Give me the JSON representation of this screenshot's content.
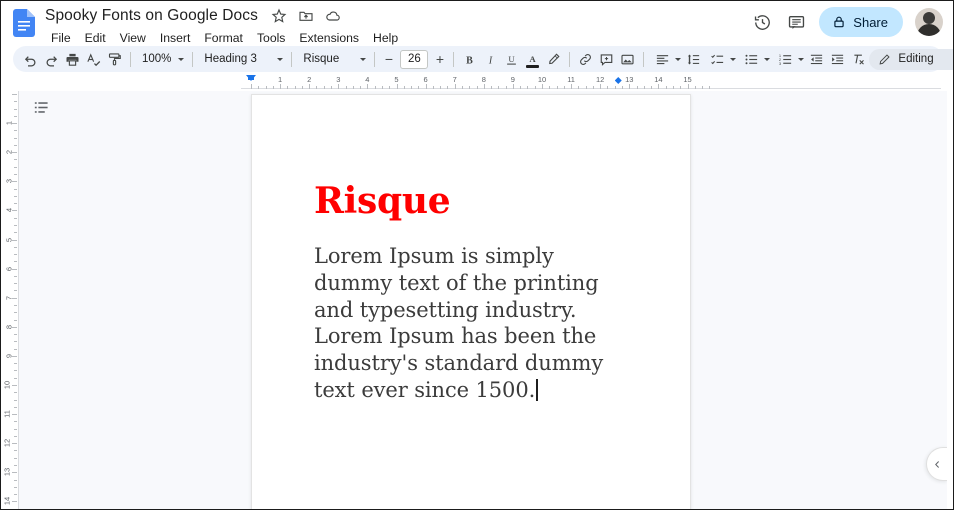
{
  "app": {
    "product": "Google Docs",
    "doc_title": "Spooky Fonts on Google Docs"
  },
  "titlebar": {
    "icons": [
      {
        "name": "star-icon",
        "label": "Star"
      },
      {
        "name": "move-to-folder-icon",
        "label": "Move"
      },
      {
        "name": "cloud-saved-icon",
        "label": "Saved to Drive"
      }
    ],
    "menus": [
      {
        "label": "File"
      },
      {
        "label": "Edit"
      },
      {
        "label": "View"
      },
      {
        "label": "Insert"
      },
      {
        "label": "Format"
      },
      {
        "label": "Tools"
      },
      {
        "label": "Extensions"
      },
      {
        "label": "Help"
      }
    ],
    "right": {
      "history_label": "Version history",
      "comments_label": "Open comment history",
      "share_label": "Share",
      "avatar_label": "Account"
    }
  },
  "toolbar": {
    "undo_label": "Undo",
    "redo_label": "Redo",
    "print_label": "Print",
    "spellcheck_label": "Spelling and grammar check",
    "paint_format_label": "Paint format",
    "zoom_value": "100%",
    "style_value": "Heading 3",
    "font_value": "Risque",
    "font_size_decrease": "−",
    "font_size_value": "26",
    "font_size_increase": "+",
    "bold_label": "B",
    "italic_label": "I",
    "underline_label": "U",
    "text_color_label": "A",
    "highlight_label": "Highlight color",
    "link_label": "Insert link",
    "comment_label": "Add comment",
    "image_label": "Insert image",
    "align_label": "Align",
    "line_spacing_label": "Line & paragraph spacing",
    "checklist_label": "Checklist",
    "bulleted_list_label": "Bulleted list",
    "numbered_list_label": "Numbered list",
    "decrease_indent_label": "Decrease indent",
    "increase_indent_label": "Increase indent",
    "clear_formatting_label": "Clear formatting",
    "mode_value": "Editing",
    "collapse_toolbar_label": "Hide the menus"
  },
  "ruler": {
    "horizontal_numbers": [
      "2",
      "1",
      "1",
      "2",
      "3",
      "4",
      "5",
      "6",
      "7",
      "8",
      "9",
      "10",
      "11",
      "12",
      "13",
      "14",
      "15"
    ],
    "vertical_numbers": [
      "2",
      "1",
      "1",
      "2",
      "3",
      "4",
      "5",
      "6",
      "7",
      "8",
      "9",
      "10",
      "11",
      "12",
      "13",
      "14"
    ],
    "left_indent_marker": "left-indent-marker",
    "tab_stop_marker": "tab-stop-marker"
  },
  "canvas": {
    "outline_label": "Show document outline",
    "collapse_label": "Collapse"
  },
  "document": {
    "heading": "Risque",
    "paragraph": "Lorem Ipsum is simply dummy text of the printing and typesetting industry. Lorem Ipsum has been the industry's standard dummy text ever since 1500."
  },
  "colors": {
    "heading_color": "#FF0000",
    "body_color": "#3B3B3B",
    "toolbar_bg": "#EDF2FA",
    "share_bg": "#C2E7FF",
    "canvas_bg": "#F8F9FC",
    "accent_blue": "#1A73E8"
  }
}
